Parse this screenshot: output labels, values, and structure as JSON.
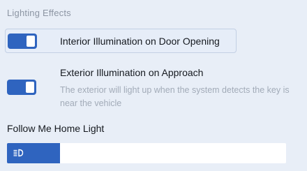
{
  "section": {
    "title": "Lighting Effects"
  },
  "settings": [
    {
      "label": "Interior Illumination on Door Opening",
      "enabled": true
    },
    {
      "label": "Exterior Illumination on Approach",
      "description": "The exterior will light up when the system detects the key is near the vehicle",
      "enabled": true
    }
  ],
  "follow_me_home": {
    "title": "Follow Me Home Light",
    "level": 0.19,
    "icon": "headlight-icon"
  },
  "colors": {
    "accent": "#2f64bf",
    "background": "#e8eef7",
    "muted_text": "#a2abb8"
  }
}
